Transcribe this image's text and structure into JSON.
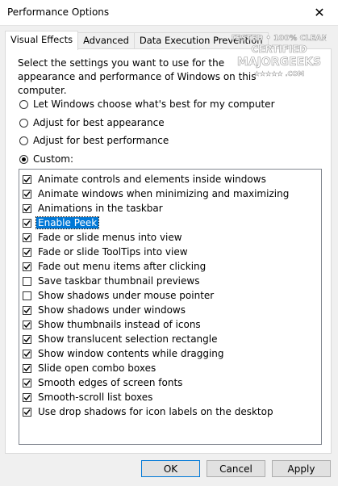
{
  "window": {
    "title": "Performance Options",
    "close_glyph": "✕"
  },
  "tabs": [
    {
      "label": "Visual Effects",
      "active": true
    },
    {
      "label": "Advanced",
      "active": false
    },
    {
      "label": "Data Execution Prevention",
      "active": false
    }
  ],
  "description": "Select the settings you want to use for the appearance and performance of Windows on this computer.",
  "radios": [
    {
      "label": "Let Windows choose what's best for my computer",
      "checked": false
    },
    {
      "label": "Adjust for best appearance",
      "checked": false
    },
    {
      "label": "Adjust for best performance",
      "checked": false
    },
    {
      "label": "Custom:",
      "checked": true
    }
  ],
  "effects": [
    {
      "label": "Animate controls and elements inside windows",
      "checked": true
    },
    {
      "label": "Animate windows when minimizing and maximizing",
      "checked": true
    },
    {
      "label": "Animations in the taskbar",
      "checked": true
    },
    {
      "label": "Enable Peek",
      "checked": true,
      "selected": true
    },
    {
      "label": "Fade or slide menus into view",
      "checked": true
    },
    {
      "label": "Fade or slide ToolTips into view",
      "checked": true
    },
    {
      "label": "Fade out menu items after clicking",
      "checked": true
    },
    {
      "label": "Save taskbar thumbnail previews",
      "checked": false
    },
    {
      "label": "Show shadows under mouse pointer",
      "checked": false
    },
    {
      "label": "Show shadows under windows",
      "checked": true
    },
    {
      "label": "Show thumbnails instead of icons",
      "checked": true
    },
    {
      "label": "Show translucent selection rectangle",
      "checked": true
    },
    {
      "label": "Show window contents while dragging",
      "checked": true
    },
    {
      "label": "Slide open combo boxes",
      "checked": true
    },
    {
      "label": "Smooth edges of screen fonts",
      "checked": true
    },
    {
      "label": "Smooth-scroll list boxes",
      "checked": true
    },
    {
      "label": "Use drop shadows for icon labels on the desktop",
      "checked": true
    }
  ],
  "buttons": {
    "ok": "OK",
    "cancel": "Cancel",
    "apply": "Apply"
  },
  "watermark": {
    "line1": "TESTED • 100% CLEAN",
    "line2": "CERTIFIED",
    "line3": "MAJORGEEKS",
    "line4": "★★★★★ .COM"
  },
  "colors": {
    "selection": "#0078d7",
    "window_bg": "#f0f0f0"
  }
}
